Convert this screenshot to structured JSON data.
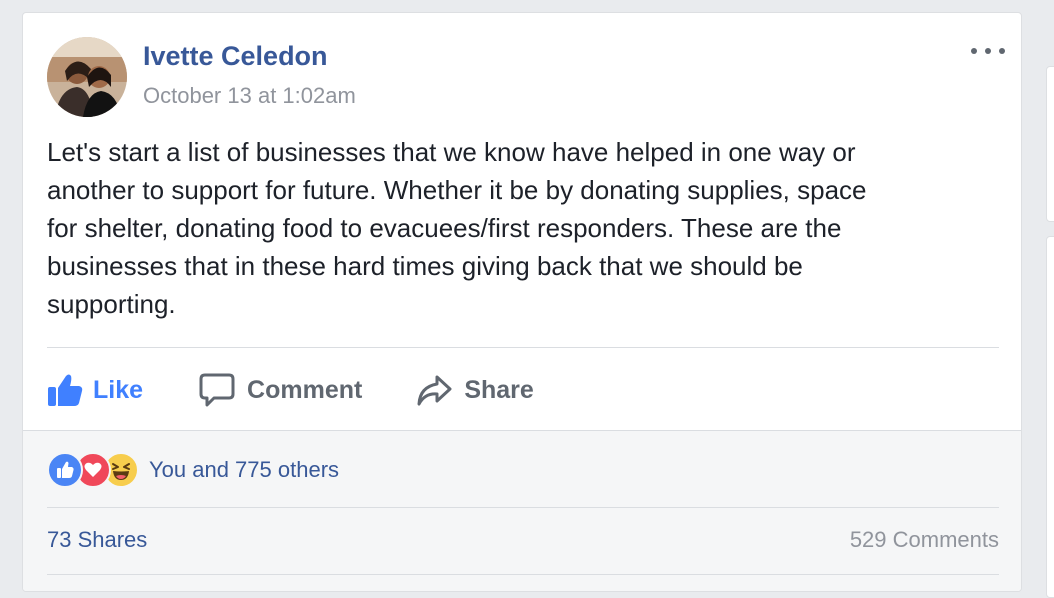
{
  "post": {
    "author": "Ivette Celedon",
    "timestamp": "October 13 at 1:02am",
    "text_lines": [
      "Let's start a list of businesses that we know have helped in one way or",
      "another to support for future. Whether it be by donating supplies, space",
      "for shelter, donating food to evacuees/first responders. These are the",
      "businesses that in these hard times giving back that we should be",
      "supporting."
    ],
    "menu_icon": "more-dots-icon"
  },
  "actions": {
    "like_label": "Like",
    "comment_label": "Comment",
    "share_label": "Share",
    "like_color": "#4080ff",
    "inactive_color": "#606770"
  },
  "stats": {
    "reactions_text": "You and 775 others",
    "reaction_icons": [
      "like-reaction-icon",
      "love-reaction-icon",
      "haha-reaction-icon"
    ],
    "shares": "73 Shares",
    "comments": "529 Comments"
  },
  "colors": {
    "link_blue": "#385898",
    "meta_gray": "#90949c",
    "page_bg": "#e9ebee"
  }
}
